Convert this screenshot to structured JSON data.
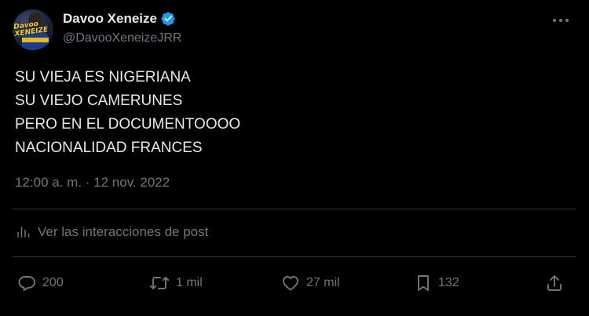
{
  "author": {
    "display_name": "Davoo Xeneize",
    "handle": "@DavooXeneizeJRR",
    "verified": true,
    "avatar_text_line1": "Davoo",
    "avatar_text_line2": "XENEIZE"
  },
  "post": {
    "lines": [
      "SU VIEJA ES NIGERIANA",
      "SU VIEJO CAMERUNES",
      "PERO EN EL DOCUMENTOOOO",
      "NACIONALIDAD FRANCES"
    ],
    "timestamp": "12:00 a. m. · 12 nov. 2022"
  },
  "interactions_link": {
    "label": "Ver las interacciones de post",
    "icon": "analytics-icon"
  },
  "actions": {
    "reply_count": "200",
    "retweet_count": "1 mil",
    "like_count": "27 mil",
    "bookmark_count": "132"
  },
  "colors": {
    "background": "#000000",
    "text_primary": "#e7e9ea",
    "text_secondary": "#71767b",
    "divider": "#2f3336",
    "verified_badge": "#1d9bf0"
  }
}
